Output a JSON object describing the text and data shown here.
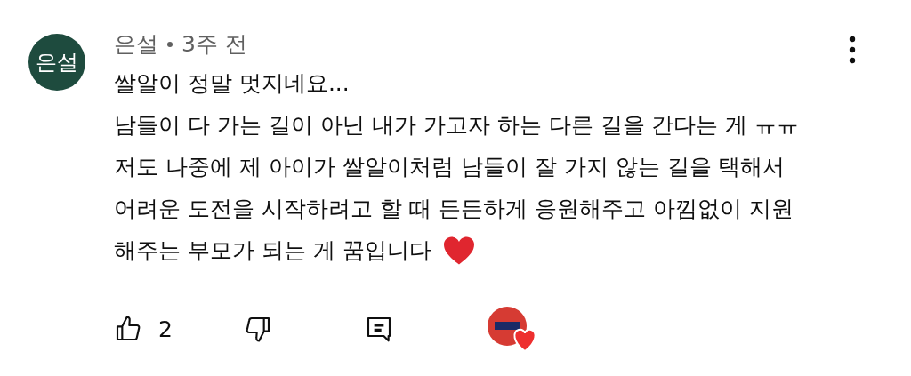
{
  "comment": {
    "avatar_text": "은설",
    "author": "은설",
    "time": "3주 전",
    "lines": [
      "쌀알이 정말 멋지네요...",
      "남들이 다 가는 길이 아닌 내가 가고자 하는 다른 길을 간다는 게 ㅠㅠ",
      "저도 나중에 제 아이가 쌀알이처럼 남들이 잘 가지 않는 길을 택해서",
      "어려운 도전을 시작하려고 할 때 든든하게 응원해주고 아낌없이 지원",
      "해주는 부모가 되는 게 꿈입니다"
    ],
    "like_count": "2",
    "liked": false,
    "disliked": false,
    "creator_hearted": true
  }
}
